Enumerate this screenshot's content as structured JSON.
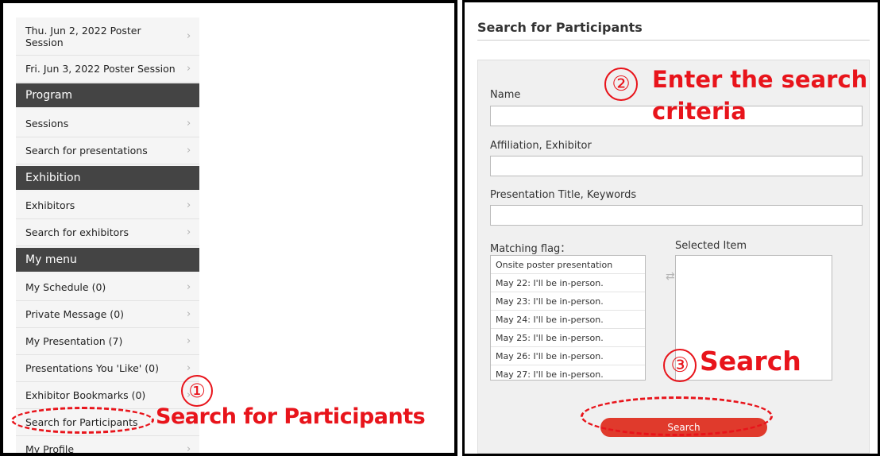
{
  "sidebar": {
    "items": [
      {
        "label": "Thu. Jun 2, 2022 Poster Session"
      },
      {
        "label": "Fri. Jun 3, 2022 Poster Session"
      }
    ],
    "program": {
      "heading": "Program",
      "items": [
        {
          "label": "Sessions"
        },
        {
          "label": "Search for presentations"
        }
      ]
    },
    "exhibition": {
      "heading": "Exhibition",
      "items": [
        {
          "label": "Exhibitors"
        },
        {
          "label": "Search for exhibitors"
        }
      ]
    },
    "my_menu": {
      "heading": "My menu",
      "items": [
        {
          "label": "My Schedule (0)"
        },
        {
          "label": "Private Message (0)"
        },
        {
          "label": "My Presentation (7)"
        },
        {
          "label": "Presentations You 'Like' (0)"
        },
        {
          "label": "Exhibitor Bookmarks (0)"
        },
        {
          "label": "Search for Participants"
        },
        {
          "label": "My Profile"
        }
      ]
    },
    "chevron": "›"
  },
  "annotations": {
    "step1_num": "①",
    "step1_text": "Search for Participants",
    "step2_num": "②",
    "step2_text_line1": "Enter the search",
    "step2_text_line2": "criteria",
    "step3_num": "③",
    "step3_text": "Search",
    "color": "#e8141b"
  },
  "search_page": {
    "title": "Search for Participants",
    "name_label": "Name",
    "name_value": "",
    "affiliation_label": "Affiliation, Exhibitor",
    "affiliation_value": "",
    "keywords_label": "Presentation Title, Keywords",
    "keywords_value": "",
    "matching_flag_label": "Matching flag：",
    "selected_item_label": "Selected Item",
    "matching_flag_options": [
      "Onsite poster presentation",
      "May 22: I'll be in-person.",
      "May 23: I'll be in-person.",
      "May 24: I'll be in-person.",
      "May 25: I'll be in-person.",
      "May 26: I'll be in-person.",
      "May 27: I'll be in-person."
    ],
    "swap_icon": "⇄",
    "search_button_label": "Search",
    "button_color": "#e03a2c"
  }
}
